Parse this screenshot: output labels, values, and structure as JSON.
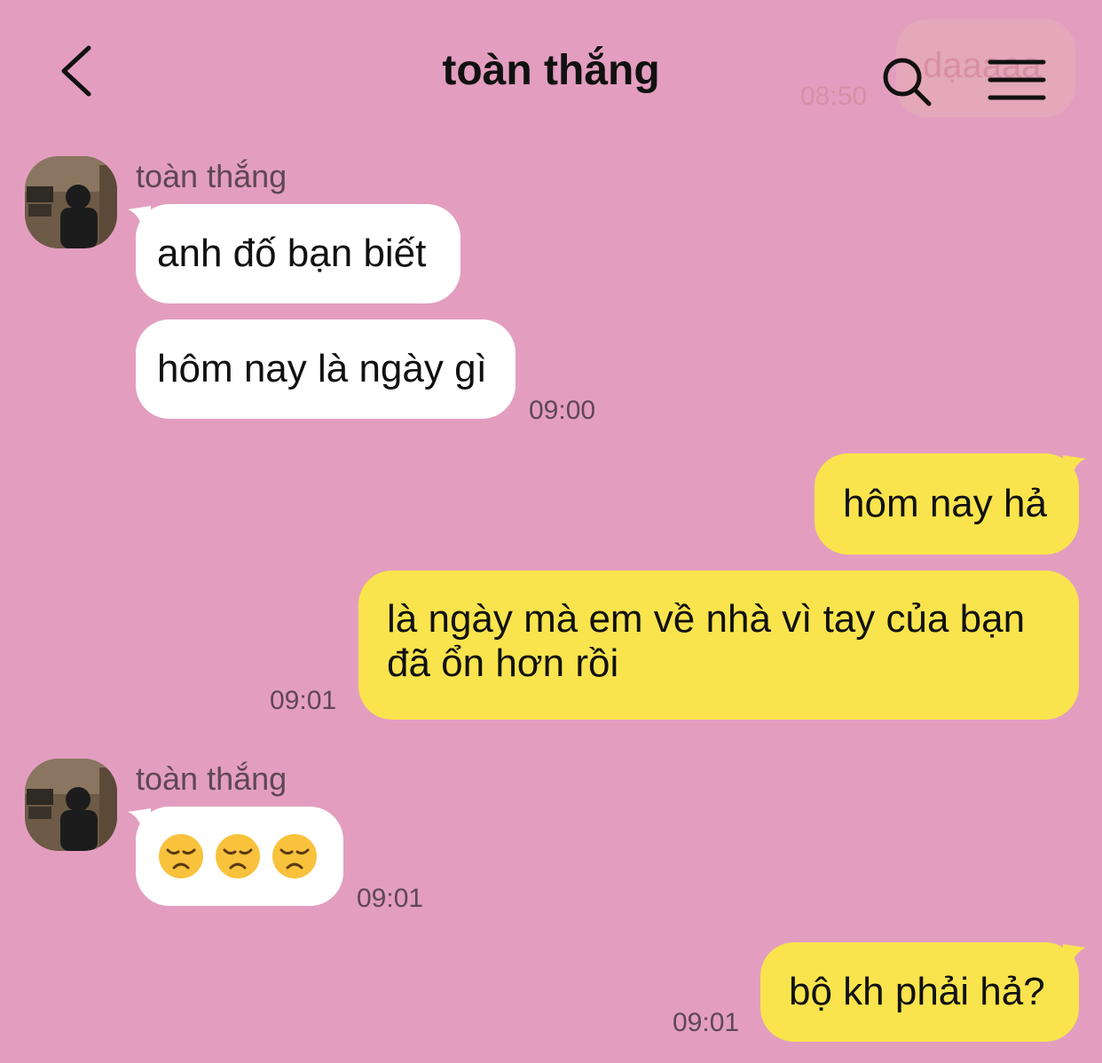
{
  "header": {
    "title": "toàn thắng",
    "back_icon": "chevron-left-icon",
    "search_icon": "search-icon",
    "menu_icon": "menu-icon"
  },
  "previous_message": {
    "text": "dạaaaa",
    "time": "08:50"
  },
  "colors": {
    "background": "#e39ebf",
    "incoming_bubble": "#ffffff",
    "outgoing_bubble": "#f9e44d"
  },
  "messages": [
    {
      "sender": "toàn thắng",
      "direction": "incoming",
      "text": "anh đố bạn biết"
    },
    {
      "direction": "incoming",
      "text": "hôm nay là ngày gì",
      "time": "09:00"
    },
    {
      "direction": "outgoing",
      "text": "hôm nay hả"
    },
    {
      "direction": "outgoing",
      "text": "là ngày mà em về nhà vì tay của bạn đã ổn hơn rồi",
      "time": "09:01"
    },
    {
      "sender": "toàn thắng",
      "direction": "incoming",
      "text": "😞😞😞",
      "emoji_icon": "disappointed-face-icon",
      "time": "09:01"
    },
    {
      "direction": "outgoing",
      "text": "bộ kh phải hả?",
      "time": "09:01"
    }
  ]
}
